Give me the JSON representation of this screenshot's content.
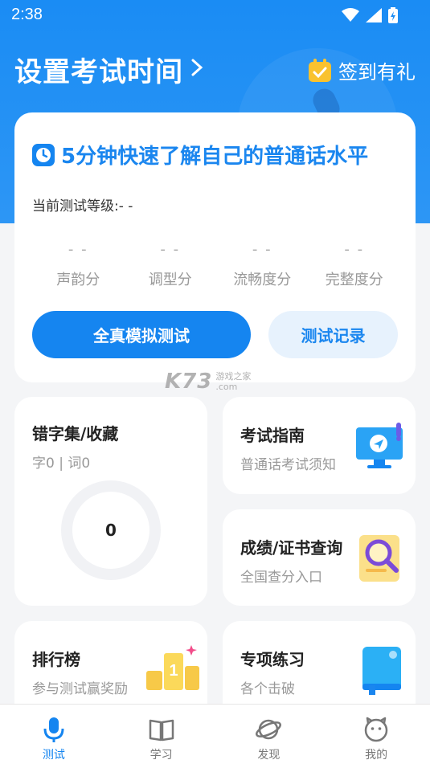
{
  "status": {
    "time": "2:38"
  },
  "header": {
    "title": "设置考试时间",
    "checkin_label": "签到有礼"
  },
  "quick_test": {
    "title": "5分钟快速了解自己的普通话水平",
    "level_label": "当前测试等级:",
    "level_value": "- -",
    "scores": [
      {
        "value": "- -",
        "label": "声韵分"
      },
      {
        "value": "- -",
        "label": "调型分"
      },
      {
        "value": "- -",
        "label": "流畅度分"
      },
      {
        "value": "- -",
        "label": "完整度分"
      }
    ],
    "primary_button": "全真模拟测试",
    "secondary_button": "测试记录"
  },
  "watermark": {
    "text": "K73",
    "small_top": "游戏之家",
    "small_bottom": ".com"
  },
  "tiles": {
    "collect": {
      "title": "错字集/收藏",
      "subtitle": "字0 | 词0",
      "count": "0"
    },
    "guide": {
      "title": "考试指南",
      "subtitle": "普通话考试须知",
      "icon": "monitor-icon"
    },
    "query": {
      "title": "成绩/证书查询",
      "subtitle": "全国查分入口",
      "icon": "certificate-search-icon"
    },
    "rank": {
      "title": "排行榜",
      "subtitle": "参与测试赢奖励",
      "icon": "podium-icon"
    },
    "practice": {
      "title": "专项练习",
      "subtitle": "各个击破",
      "icon": "book-icon"
    }
  },
  "nav": [
    {
      "label": "测试",
      "icon": "mic-icon",
      "active": true
    },
    {
      "label": "学习",
      "icon": "book-open-icon",
      "active": false
    },
    {
      "label": "发现",
      "icon": "planet-icon",
      "active": false
    },
    {
      "label": "我的",
      "icon": "face-icon",
      "active": false
    }
  ],
  "colors": {
    "primary": "#1585f0",
    "hero": "#1a8cf4",
    "background": "#f4f5f7",
    "checkin_icon": "#f9c22e"
  }
}
